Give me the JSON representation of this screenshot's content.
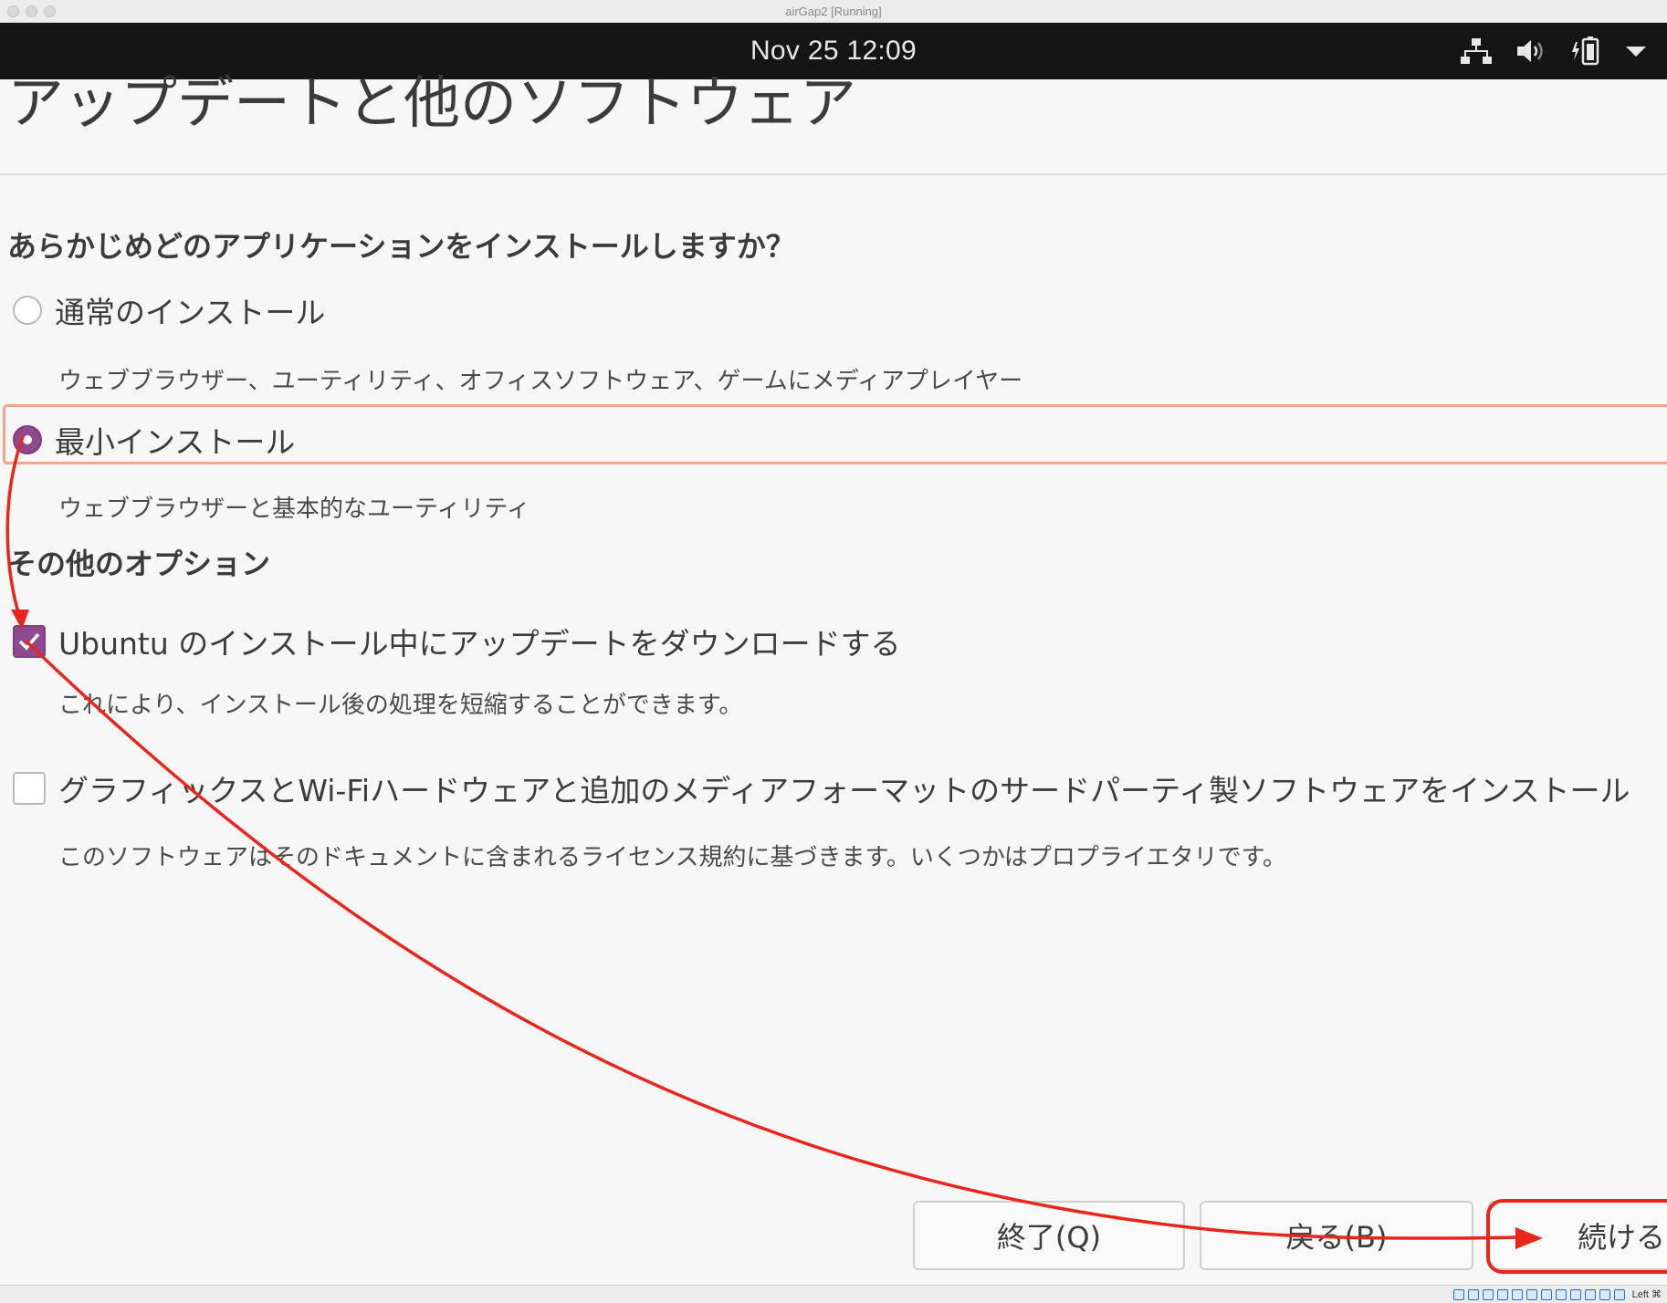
{
  "window": {
    "title": "airGap2 [Running]"
  },
  "topbar": {
    "clock": "Nov 25  12:09",
    "icons": [
      "network-icon",
      "volume-icon",
      "battery-icon",
      "system-menu-arrow-icon"
    ]
  },
  "page": {
    "heading": "アップデートと他のソフトウェア",
    "question": "あらかじめどのアプリケーションをインストールしますか？",
    "options": [
      {
        "label": "通常のインストール",
        "description": "ウェブブラウザー、ユーティリティ、オフィスソフトウェア、ゲームにメディアプレイヤー",
        "selected": false
      },
      {
        "label": "最小インストール",
        "description": "ウェブブラウザーと基本的なユーティリティ",
        "selected": true
      }
    ],
    "other_heading": "その他のオプション",
    "checks": [
      {
        "label": "Ubuntu のインストール中にアップデートをダウンロードする",
        "description": "これにより、インストール後の処理を短縮することができます。",
        "checked": true
      },
      {
        "label": "グラフィックスとWi-Fiハードウェアと追加のメディアフォーマットのサードパーティ製ソフトウェアをインストール",
        "description": "このソフトウェアはそのドキュメントに含まれるライセンス規約に基づきます。いくつかはプロプライエタリです。",
        "checked": false
      }
    ]
  },
  "buttons": {
    "quit": "終了(Q)",
    "back": "戻る(B)",
    "continue": "続ける"
  },
  "statusbar": {
    "host_key": "Left ⌘"
  },
  "colors": {
    "accent": "#8f4a8f",
    "focus_outline": "#f2a58a",
    "annotation": "#e8261c",
    "topbar": "#151515"
  }
}
